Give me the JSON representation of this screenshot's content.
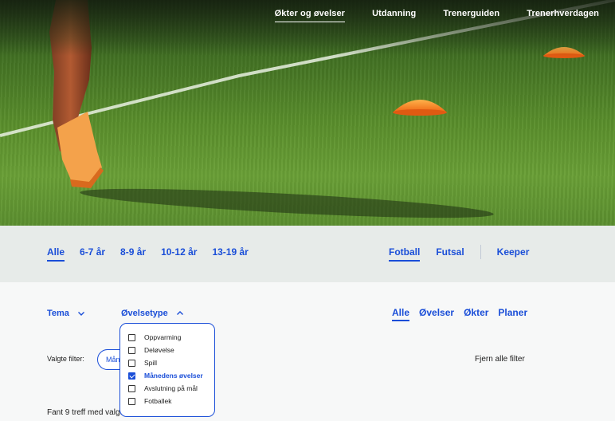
{
  "nav": {
    "items": [
      {
        "label": "Økter og øvelser",
        "active": true
      },
      {
        "label": "Utdanning",
        "active": false
      },
      {
        "label": "Trenerguiden",
        "active": false
      },
      {
        "label": "Trenerhverdagen",
        "active": false
      }
    ]
  },
  "age_filters": [
    {
      "label": "Alle",
      "active": true
    },
    {
      "label": "6-7 år",
      "active": false
    },
    {
      "label": "8-9 år",
      "active": false
    },
    {
      "label": "10-12 år",
      "active": false
    },
    {
      "label": "13-19 år",
      "active": false
    }
  ],
  "sport_filters": [
    {
      "label": "Fotball",
      "active": true
    },
    {
      "label": "Futsal",
      "active": false
    },
    {
      "label": "Keeper",
      "active": false
    }
  ],
  "filters": {
    "tema_label": "Tema",
    "ovelsetype_label": "Øvelsetype",
    "chosen_label": "Valgte filter:",
    "chip_label": "Månedens øvelser",
    "clear_all_label": "Fjern alle filter",
    "results_text": "Fant 9 treff med valgte filter"
  },
  "type_filters": [
    {
      "label": "Alle",
      "active": true
    },
    {
      "label": "Øvelser",
      "active": false
    },
    {
      "label": "Økter",
      "active": false
    },
    {
      "label": "Planer",
      "active": false
    }
  ],
  "dropdown": {
    "options": [
      {
        "label": "Oppvarming",
        "checked": false
      },
      {
        "label": "Deløvelse",
        "checked": false
      },
      {
        "label": "Spill",
        "checked": false
      },
      {
        "label": "Månedens øvelser",
        "checked": true
      },
      {
        "label": "Avslutning på mål",
        "checked": false
      },
      {
        "label": "Fotballek",
        "checked": false
      }
    ]
  },
  "colors": {
    "accent": "#1a4ed8",
    "age_bar_bg": "#e7ebe9",
    "page_bg": "#f7f8f8"
  }
}
